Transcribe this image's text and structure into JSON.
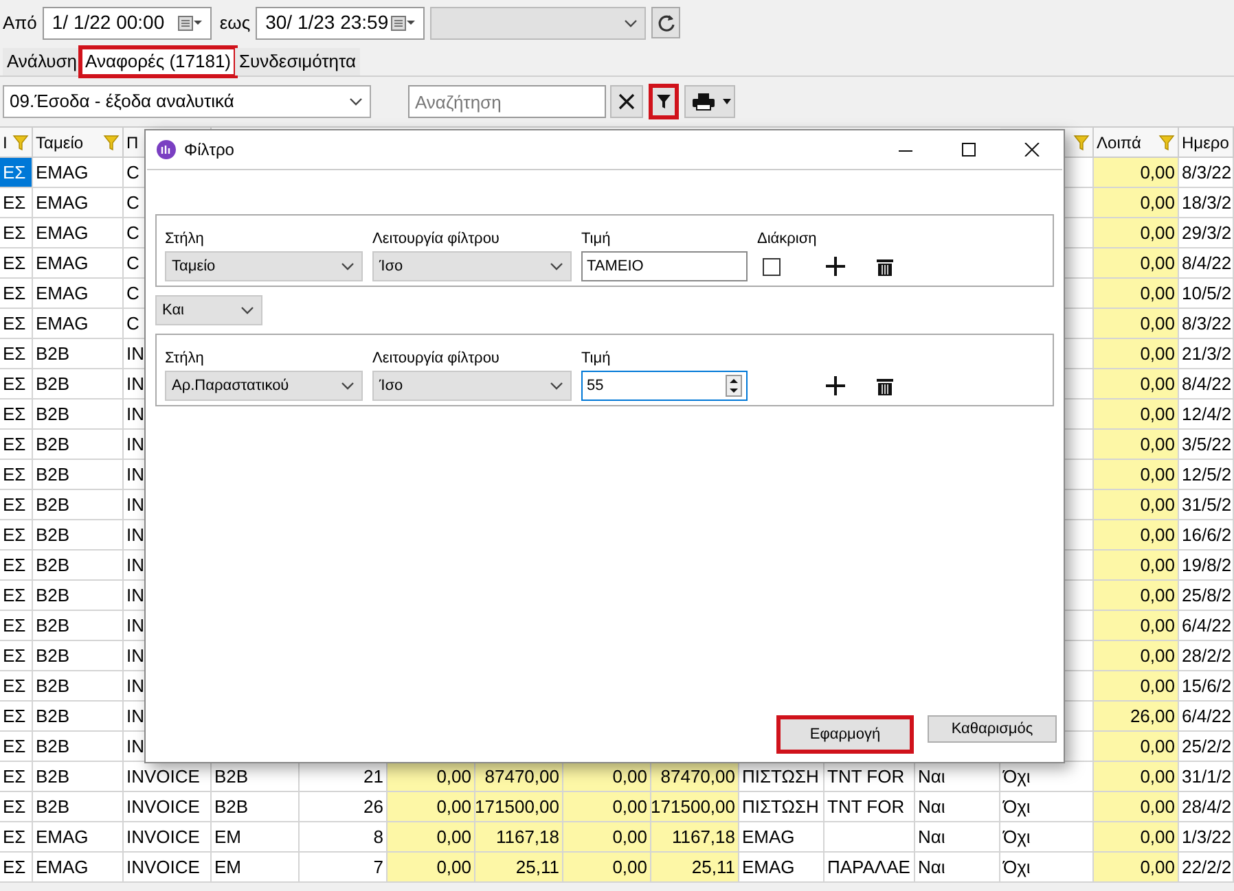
{
  "date_range": {
    "from_label": "Από",
    "from": "1/  1/22 00:00",
    "to_label": "εως",
    "to": "30/  1/23 23:59"
  },
  "tabs": [
    {
      "label": "Ανάλυση",
      "selected": false,
      "highlighted": false
    },
    {
      "label": "Αναφορές (17181)",
      "selected": true,
      "highlighted": true
    },
    {
      "label": "Συνδεσιμότητα",
      "selected": false,
      "highlighted": false
    }
  ],
  "toolbar": {
    "report": "09.Έσοδα - έξοδα αναλυτικά",
    "search": {
      "placeholder": "Αναζήτηση"
    },
    "filter_highlighted": true
  },
  "table": {
    "columns": [
      {
        "label": "Ι",
        "filter": true
      },
      {
        "label": "Ταμείο",
        "filter": true
      },
      {
        "label": "Π",
        "filter": false
      },
      {
        "filter": true
      },
      {
        "label": "Λοιπά",
        "filter": true
      },
      {
        "label": "Ημερο",
        "filter": false
      }
    ],
    "rows": [
      {
        "selected": true,
        "cells": [
          "ΕΣ",
          "EMAG",
          "C"
        ],
        "other": "0,00",
        "date": "8/3/22"
      },
      {
        "selected": false,
        "cells": [
          "ΕΣ",
          "EMAG",
          "C"
        ],
        "other": "0,00",
        "date": "18/3/2"
      },
      {
        "selected": false,
        "cells": [
          "ΕΣ",
          "EMAG",
          "C"
        ],
        "other": "0,00",
        "date": "29/3/2"
      },
      {
        "selected": false,
        "cells": [
          "ΕΣ",
          "EMAG",
          "C"
        ],
        "other": "0,00",
        "date": "8/4/22"
      },
      {
        "selected": false,
        "cells": [
          "ΕΣ",
          "EMAG",
          "C"
        ],
        "other": "0,00",
        "date": "10/5/2"
      },
      {
        "selected": false,
        "cells": [
          "ΕΣ",
          "EMAG",
          "C"
        ],
        "other": "0,00",
        "date": "8/3/22"
      },
      {
        "selected": false,
        "cells": [
          "ΕΣ",
          "B2B",
          "IN"
        ],
        "other": "0,00",
        "date": "21/3/2"
      },
      {
        "selected": false,
        "cells": [
          "ΕΣ",
          "B2B",
          "IN"
        ],
        "other": "0,00",
        "date": "8/4/22"
      },
      {
        "selected": false,
        "cells": [
          "ΕΣ",
          "B2B",
          "IN"
        ],
        "other": "0,00",
        "date": "12/4/2"
      },
      {
        "selected": false,
        "cells": [
          "ΕΣ",
          "B2B",
          "IN"
        ],
        "other": "0,00",
        "date": "3/5/22"
      },
      {
        "selected": false,
        "cells": [
          "ΕΣ",
          "B2B",
          "IN"
        ],
        "other": "0,00",
        "date": "12/5/2"
      },
      {
        "selected": false,
        "cells": [
          "ΕΣ",
          "B2B",
          "IN"
        ],
        "other": "0,00",
        "date": "31/5/2"
      },
      {
        "selected": false,
        "cells": [
          "ΕΣ",
          "B2B",
          "IN"
        ],
        "other": "0,00",
        "date": "16/6/2"
      },
      {
        "selected": false,
        "cells": [
          "ΕΣ",
          "B2B",
          "IN"
        ],
        "other": "0,00",
        "date": "19/8/2"
      },
      {
        "selected": false,
        "cells": [
          "ΕΣ",
          "B2B",
          "IN"
        ],
        "other": "0,00",
        "date": "25/8/2"
      },
      {
        "selected": false,
        "cells": [
          "ΕΣ",
          "B2B",
          "IN"
        ],
        "other": "0,00",
        "date": "6/4/22"
      },
      {
        "selected": false,
        "cells": [
          "ΕΣ",
          "B2B",
          "IN"
        ],
        "other": "0,00",
        "date": "28/2/2"
      },
      {
        "selected": false,
        "cells": [
          "ΕΣ",
          "B2B",
          "IN"
        ],
        "other": "0,00",
        "date": "15/6/2"
      },
      {
        "selected": false,
        "cells": [
          "ΕΣ",
          "B2B",
          "IN"
        ],
        "other": "26,00",
        "date": "6/4/22"
      },
      {
        "selected": false,
        "cells": [
          "ΕΣ",
          "B2B",
          "IN"
        ],
        "other": "0,00",
        "date": "25/2/2"
      },
      {
        "selected": false,
        "cells": [
          "ΕΣ",
          "B2B",
          "INVOICE",
          "B2B",
          "21",
          "0,00",
          "87470,00",
          "0,00",
          "87470,00",
          "ΠΙΣΤΩΣΗ",
          "TNT FOR",
          "Ναι",
          "Όχι"
        ],
        "other": "0,00",
        "date": "31/1/2"
      },
      {
        "selected": false,
        "cells": [
          "ΕΣ",
          "B2B",
          "INVOICE",
          "B2B",
          "26",
          "0,00",
          "171500,00",
          "0,00",
          "171500,00",
          "ΠΙΣΤΩΣΗ",
          "TNT FOR",
          "Ναι",
          "Όχι"
        ],
        "other": "0,00",
        "date": "28/4/2"
      },
      {
        "selected": false,
        "cells": [
          "ΕΣ",
          "EMAG",
          "INVOICE",
          "EM",
          "8",
          "0,00",
          "1167,18",
          "0,00",
          "1167,18",
          "EMAG",
          null,
          "Ναι",
          "Όχι"
        ],
        "other": "0,00",
        "date": "1/3/22"
      },
      {
        "selected": false,
        "cells": [
          "ΕΣ",
          "EMAG",
          "INVOICE",
          "EM",
          "7",
          "0,00",
          "25,11",
          "0,00",
          "25,11",
          "EMAG",
          "ΠΑΡΑΛΑΕ",
          "Ναι",
          "Όχι"
        ],
        "other": "0,00",
        "date": "22/2/2"
      }
    ]
  },
  "dialog": {
    "title": "Φίλτρο",
    "filters": [
      {
        "kind": "text",
        "column_label": "Στήλη",
        "column": "Ταμείο",
        "operation_label": "Λειτουργία φίλτρου",
        "operation": "Ίσο",
        "value_label": "Τιμή",
        "value": "ΤΑΜΕΙΟ",
        "case_label": "Διάκριση",
        "case_sensitive": false
      },
      {
        "kind": "number",
        "column_label": "Στήλη",
        "column": "Αρ.Παραστατικού",
        "operation_label": "Λειτουργία φίλτρου",
        "operation": "Ίσο",
        "value_label": "Τιμή",
        "value": "55"
      }
    ],
    "connector": "Και",
    "buttons": [
      {
        "label": "Εφαρμογή",
        "highlighted": true
      },
      {
        "label": "Καθαρισμός",
        "highlighted": false
      }
    ]
  }
}
